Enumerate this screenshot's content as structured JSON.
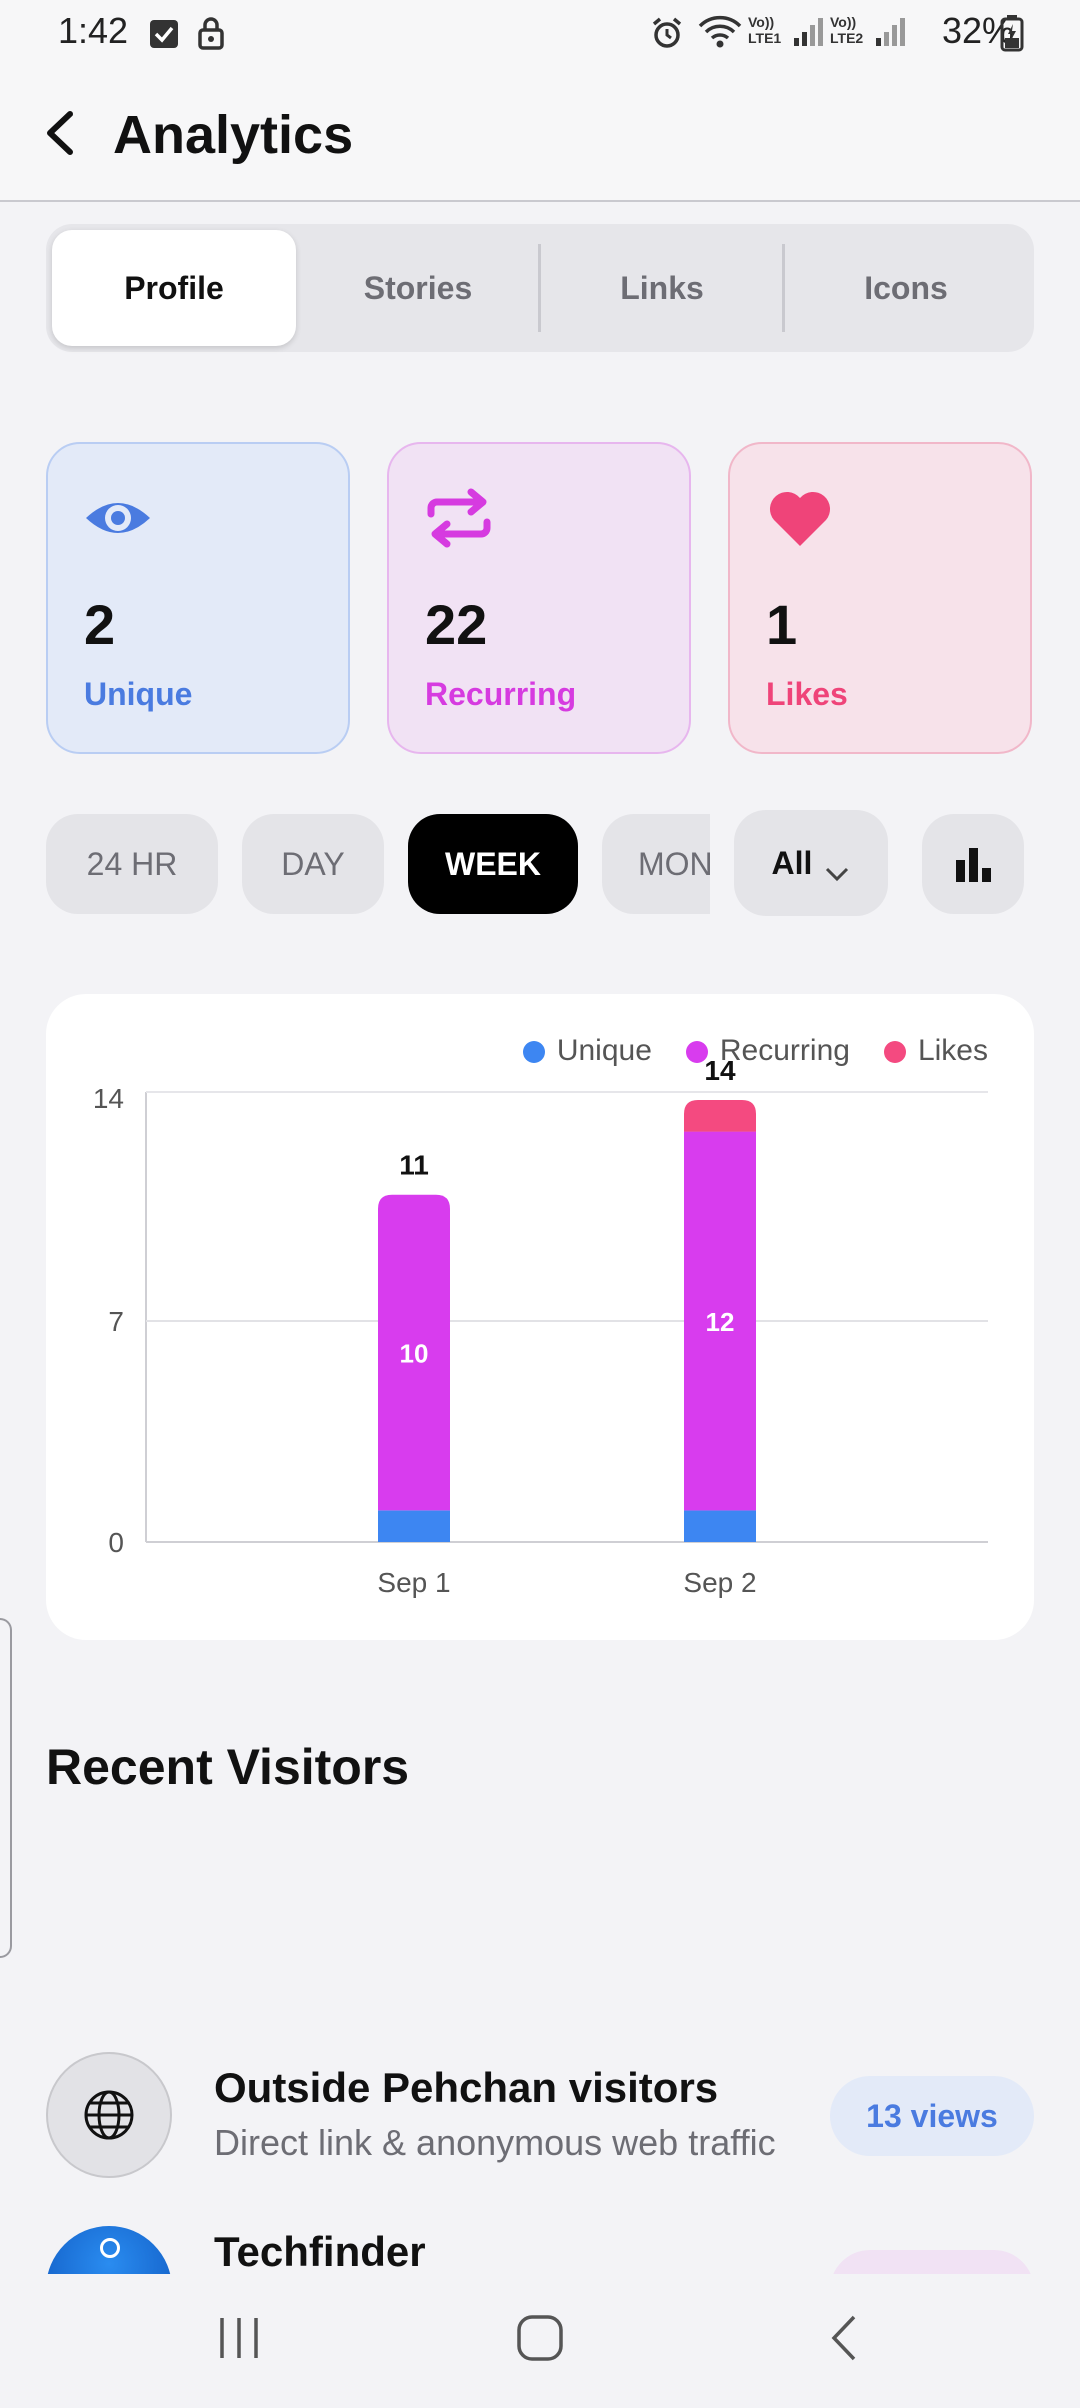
{
  "status_bar": {
    "time": "1:42",
    "battery": "32%",
    "network_labels": [
      "Vo)) LTE1",
      "Vo)) LTE2"
    ]
  },
  "header": {
    "title": "Analytics"
  },
  "tabs": [
    {
      "label": "Profile",
      "active": true
    },
    {
      "label": "Stories",
      "active": false
    },
    {
      "label": "Links",
      "active": false
    },
    {
      "label": "Icons",
      "active": false
    }
  ],
  "stats": [
    {
      "icon": "eye-icon",
      "value": "2",
      "label": "Unique",
      "color": "#4a7be0",
      "bg": "#e3eaf8",
      "border": "#b9cdf3"
    },
    {
      "icon": "repeat-icon",
      "value": "22",
      "label": "Recurring",
      "color": "#d63be0",
      "bg": "#f1e2f4",
      "border": "#e7b6ee"
    },
    {
      "icon": "heart-icon",
      "value": "1",
      "label": "Likes",
      "color": "#ef4479",
      "bg": "#f7e2ea",
      "border": "#f1b7c9"
    }
  ],
  "filters": {
    "ranges": [
      "24 HR",
      "DAY",
      "WEEK",
      "MON"
    ],
    "active_range": "WEEK",
    "dropdown_value": "All"
  },
  "chart_data": {
    "type": "bar",
    "stacked": true,
    "categories": [
      "Sep 1",
      "Sep 2"
    ],
    "series": [
      {
        "name": "Unique",
        "values": [
          1,
          1
        ],
        "color": "#3d86f2"
      },
      {
        "name": "Recurring",
        "values": [
          10,
          12
        ],
        "color": "#d83cee"
      },
      {
        "name": "Likes",
        "values": [
          0,
          1
        ],
        "color": "#f44a80"
      }
    ],
    "totals": [
      11,
      14
    ],
    "segment_labels": [
      "10",
      "12"
    ],
    "ylim": [
      0,
      14
    ],
    "yticks": [
      "0",
      "7",
      "14"
    ],
    "grid": true,
    "legend_position": "top-right"
  },
  "recent_visitors": {
    "title": "Recent Visitors",
    "items": [
      {
        "name": "Outside Pehchan visitors",
        "subtitle": "Direct link & anonymous web traffic",
        "views": "13 views",
        "icon": "globe-icon"
      },
      {
        "name": "Techfinder",
        "subtitle": "",
        "views": "",
        "icon": "avatar"
      }
    ]
  }
}
